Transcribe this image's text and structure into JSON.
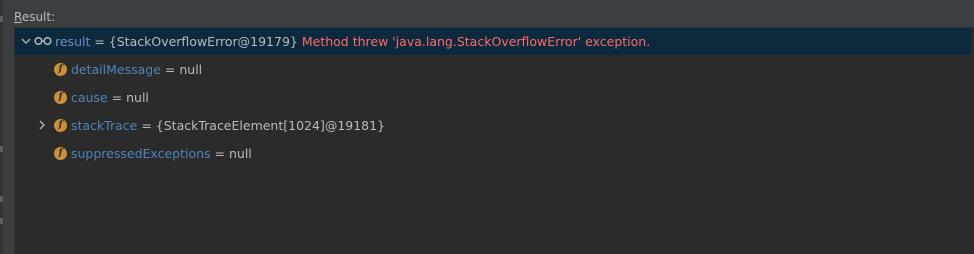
{
  "header": {
    "label_mnemonic": "R",
    "label_rest": "esult:"
  },
  "tree": {
    "root": {
      "name": "result",
      "equals": " = ",
      "value": "{StackOverflowError@19179}",
      "message": "Method threw 'java.lang.StackOverflowError' exception.",
      "expanded": true,
      "icon": "watch-glasses-icon"
    },
    "children": [
      {
        "name": "detailMessage",
        "equals": " = ",
        "value": "null",
        "icon": "field-icon",
        "icon_glyph": "f",
        "expandable": false
      },
      {
        "name": "cause",
        "equals": " = ",
        "value": "null",
        "icon": "field-icon",
        "icon_glyph": "f",
        "expandable": false
      },
      {
        "name": "stackTrace",
        "equals": " = ",
        "value": "{StackTraceElement[1024]@19181}",
        "icon": "field-icon",
        "icon_glyph": "f",
        "expandable": true
      },
      {
        "name": "suppressedExceptions",
        "equals": " = ",
        "value": "null",
        "icon": "field-icon",
        "icon_glyph": "f",
        "expandable": false
      }
    ]
  },
  "colors": {
    "background": "#3c3f41",
    "panel": "#2b2b2b",
    "selection": "#0d293e",
    "error_text": "#ff6b68",
    "field_name": "#6897bb",
    "field_icon": "#c99038"
  }
}
